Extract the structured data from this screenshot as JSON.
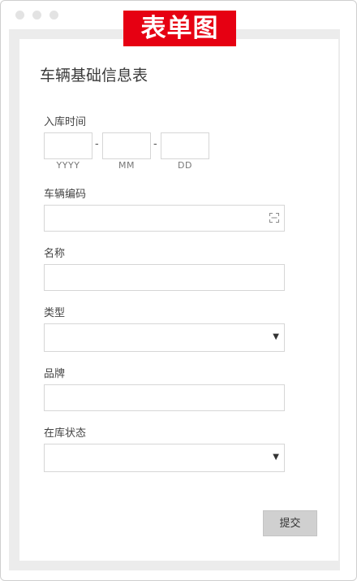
{
  "banner": "表单图",
  "form": {
    "title": "车辆基础信息表",
    "entry_time": {
      "label": "入库时间",
      "separator": "-",
      "hints": [
        "YYYY",
        "MM",
        "DD"
      ]
    },
    "vehicle_code": {
      "label": "车辆编码",
      "icon": "scan-icon"
    },
    "name": {
      "label": "名称"
    },
    "type": {
      "label": "类型",
      "icon": "dropdown-caret-icon"
    },
    "brand": {
      "label": "品牌"
    },
    "stock_status": {
      "label": "在库状态",
      "icon": "dropdown-caret-icon"
    },
    "submit_label": "提交"
  }
}
